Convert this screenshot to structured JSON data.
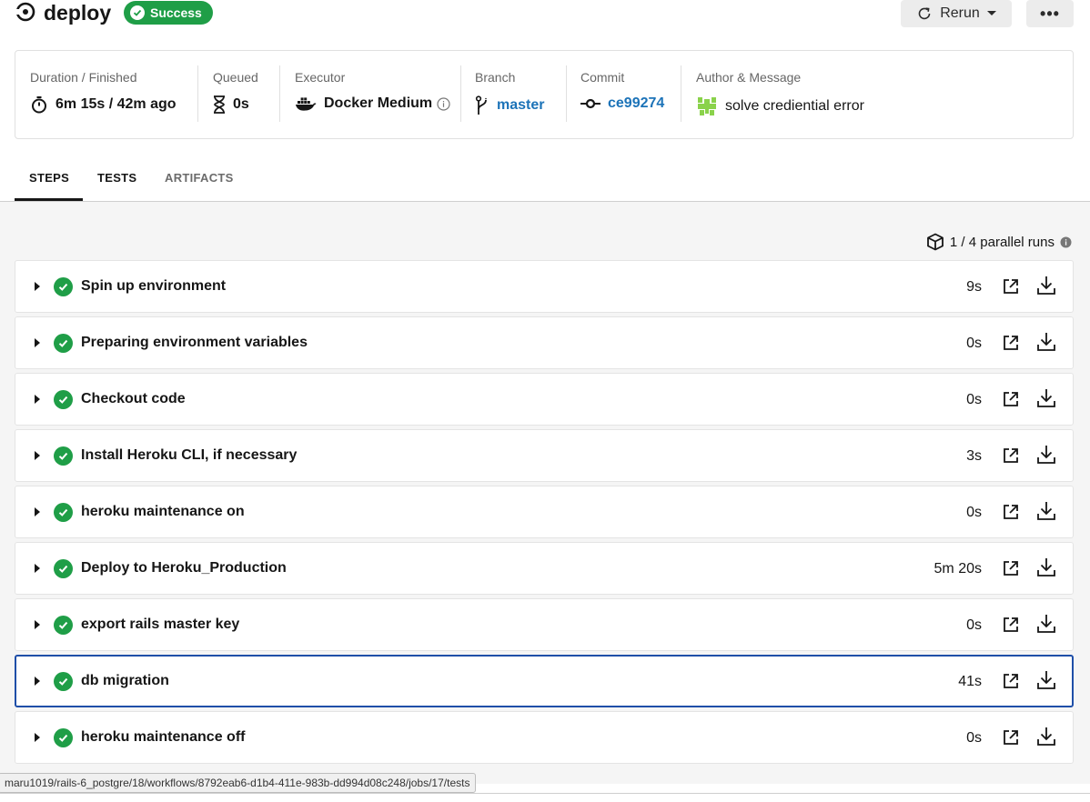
{
  "header": {
    "title": "deploy",
    "status_badge": "Success",
    "rerun_label": "Rerun",
    "more_label": "•••"
  },
  "info": {
    "duration": {
      "label": "Duration / Finished",
      "value": "6m 15s / 42m ago"
    },
    "queued": {
      "label": "Queued",
      "value": "0s"
    },
    "executor": {
      "label": "Executor",
      "value": "Docker Medium"
    },
    "branch": {
      "label": "Branch",
      "value": "master"
    },
    "commit": {
      "label": "Commit",
      "value": "ce99274"
    },
    "author": {
      "label": "Author & Message",
      "value": "solve crediential error"
    }
  },
  "tabs": [
    "STEPS",
    "TESTS",
    "ARTIFACTS"
  ],
  "parallel_runs": "1 / 4 parallel runs",
  "steps": [
    {
      "name": "Spin up environment",
      "duration": "9s"
    },
    {
      "name": "Preparing environment variables",
      "duration": "0s"
    },
    {
      "name": "Checkout code",
      "duration": "0s"
    },
    {
      "name": "Install Heroku CLI, if necessary",
      "duration": "3s"
    },
    {
      "name": "heroku maintenance on",
      "duration": "0s"
    },
    {
      "name": "Deploy to Heroku_Production",
      "duration": "5m 20s"
    },
    {
      "name": "export rails master key",
      "duration": "0s"
    },
    {
      "name": "db migration",
      "duration": "41s"
    },
    {
      "name": "heroku maintenance off",
      "duration": "0s"
    }
  ],
  "status_url": "maru1019/rails-6_postgre/18/workflows/8792eab6-d1b4-411e-983b-dd994d08c248/jobs/17/tests",
  "colors": {
    "success": "#1f9e47",
    "link": "#1c73b8",
    "selected_border": "#1f4fa8"
  }
}
